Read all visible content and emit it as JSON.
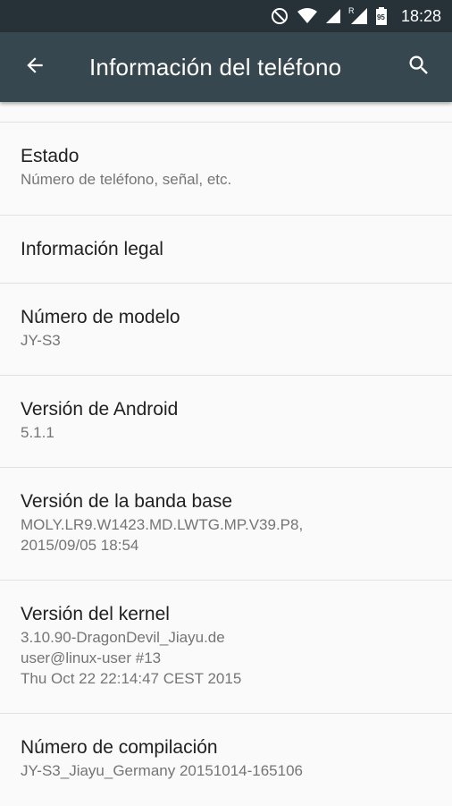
{
  "status_bar": {
    "time": "18:28",
    "battery_level": "95",
    "network_roaming": "R",
    "icons": [
      "do-not-disturb-icon",
      "wifi-icon",
      "signal-icon",
      "roaming-signal-icon",
      "battery-icon"
    ]
  },
  "toolbar": {
    "title": "Información del teléfono",
    "back_icon": "arrow-back-icon",
    "search_icon": "search-icon"
  },
  "items": [
    {
      "title": "Estado",
      "summary": "Número de teléfono, señal, etc."
    },
    {
      "title": "Información legal",
      "summary": ""
    },
    {
      "title": "Número de modelo",
      "summary": "JY-S3"
    },
    {
      "title": "Versión de Android",
      "summary": "5.1.1"
    },
    {
      "title": "Versión de la banda base",
      "summary": "MOLY.LR9.W1423.MD.LWTG.MP.V39.P8,\n2015/09/05 18:54"
    },
    {
      "title": "Versión del kernel",
      "summary": "3.10.90-DragonDevil_Jiayu.de\nuser@linux-user #13\nThu Oct 22 22:14:47 CEST 2015"
    },
    {
      "title": "Número de compilación",
      "summary": "JY-S3_Jiayu_Germany 20151014-165106"
    }
  ],
  "colors": {
    "status_bar_bg": "#263238",
    "toolbar_bg": "#37474f",
    "background": "#fafafa",
    "divider": "#e2e2e2",
    "title_text": "#212121",
    "summary_text": "#757575"
  }
}
